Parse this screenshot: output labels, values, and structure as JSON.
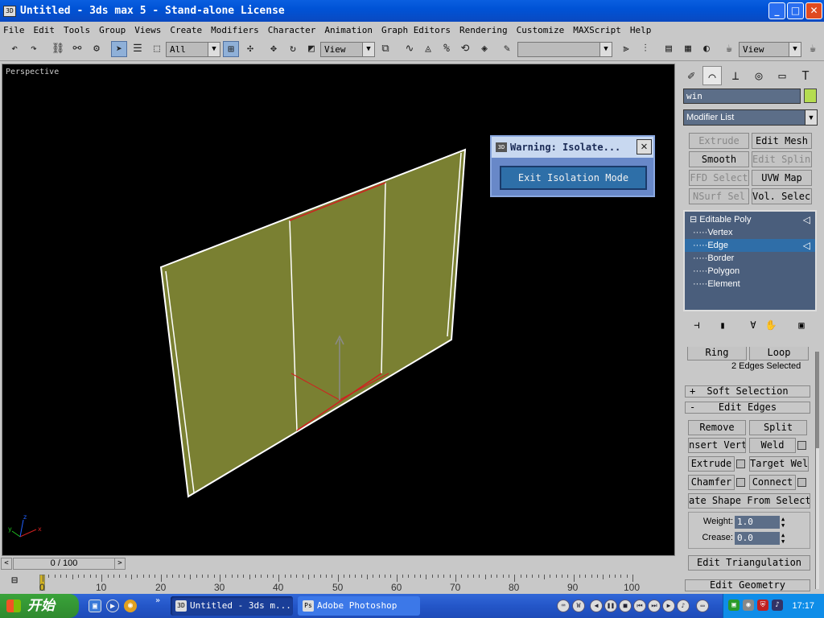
{
  "window": {
    "title": "Untitled - 3ds max 5 - Stand-alone License",
    "app_icon": "3ds-max-icon",
    "minimize": "_",
    "maximize": "□",
    "close": "✕"
  },
  "menu": [
    "File",
    "Edit",
    "Tools",
    "Group",
    "Views",
    "Create",
    "Modifiers",
    "Character",
    "Animation",
    "Graph Editors",
    "Rendering",
    "Customize",
    "MAXScript",
    "Help"
  ],
  "toolbar": {
    "selection_filter": "All",
    "ref_coord": "View",
    "named_selection": "",
    "render_view": "View"
  },
  "viewport": {
    "label": "Perspective",
    "background": "#000000",
    "plane_color": "#7a8032",
    "axis_labels": {
      "x": "x",
      "y": "y",
      "z": "z"
    }
  },
  "dialog": {
    "title": "Warning: Isolate...",
    "button": "Exit Isolation Mode",
    "close": "✕"
  },
  "command_panel": {
    "object_name": "win",
    "object_color": "#b5dc50",
    "modifier_list": "Modifier List",
    "modifier_buttons": [
      {
        "label": "Extrude",
        "enabled": false
      },
      {
        "label": "Edit Mesh",
        "enabled": true
      },
      {
        "label": "Smooth",
        "enabled": true
      },
      {
        "label": "Edit Spline",
        "enabled": false
      },
      {
        "label": "FFD Select",
        "enabled": false
      },
      {
        "label": "UVW Map",
        "enabled": true
      },
      {
        "label": "NSurf Sel",
        "enabled": false
      },
      {
        "label": "Vol. Select",
        "enabled": true
      }
    ],
    "stack": [
      {
        "label": "Editable Poly",
        "level": 0,
        "prefix": "⊟"
      },
      {
        "label": "Vertex",
        "level": 1,
        "prefix": "·····"
      },
      {
        "label": "Edge",
        "level": 1,
        "prefix": "·····",
        "selected": true
      },
      {
        "label": "Border",
        "level": 1,
        "prefix": "·····"
      },
      {
        "label": "Polygon",
        "level": 1,
        "prefix": "·····"
      },
      {
        "label": "Element",
        "level": 1,
        "prefix": "·····"
      }
    ],
    "rollout": {
      "ring": "Ring",
      "loop": "Loop",
      "selection_status": "2 Edges Selected",
      "soft_selection": "Soft Selection",
      "soft_selection_sign": "+",
      "edit_edges": "Edit Edges",
      "edit_edges_sign": "-",
      "remove": "Remove",
      "split": "Split",
      "insert_vertex": "nsert Verte",
      "weld": "Weld",
      "extrude": "Extrude",
      "target_weld": "Target Weld",
      "chamfer": "Chamfer",
      "connect": "Connect",
      "create_shape": "ate Shape From Select",
      "weight_label": "Weight:",
      "weight_value": "1.0",
      "crease_label": "Crease:",
      "crease_value": "0.0",
      "edit_triangulation": "Edit Triangulation",
      "edit_geometry": "Edit Geometry"
    }
  },
  "time_slider": {
    "label": "0 / 100",
    "left": "<",
    "right": ">"
  },
  "trackbar": {
    "ticks": [
      "0",
      "10",
      "20",
      "30",
      "40",
      "50",
      "60",
      "70",
      "80",
      "90",
      "100"
    ]
  },
  "taskbar": {
    "start": "开始",
    "tasks": [
      {
        "label": "Untitled - 3ds m...",
        "active": true
      },
      {
        "label": "Adobe Photoshop",
        "active": false
      }
    ],
    "clock": "17:17"
  }
}
